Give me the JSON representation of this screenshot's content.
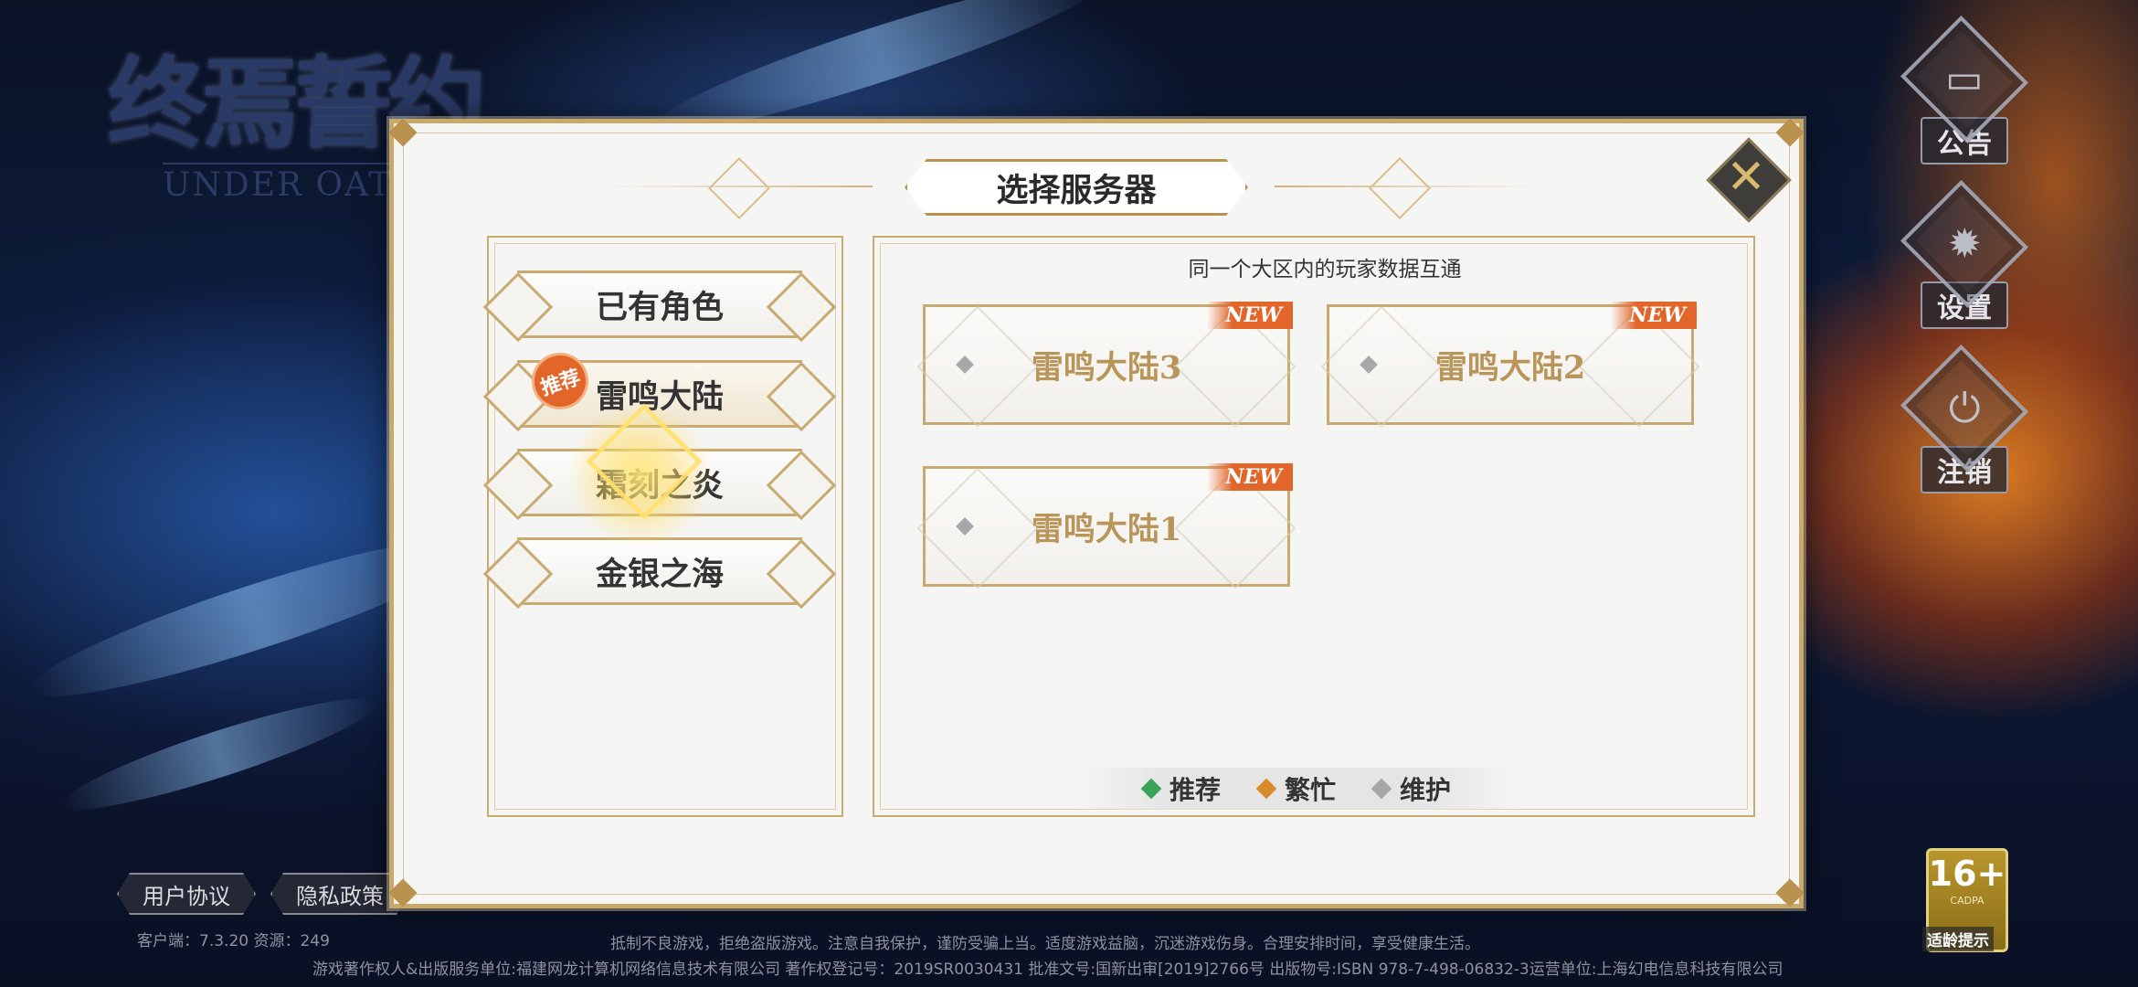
{
  "logo": {
    "cn": "终焉誓约",
    "en": "UNDER OATH"
  },
  "side_menu": [
    {
      "label": "公告",
      "icon": "notice-icon",
      "glyph": "▭"
    },
    {
      "label": "设置",
      "icon": "gear-icon",
      "glyph": "✹"
    },
    {
      "label": "注销",
      "icon": "power-icon",
      "glyph": "⏻"
    }
  ],
  "bottom": {
    "user_agreement": "用户协议",
    "privacy_policy": "隐私政策",
    "version": "客户端：7.3.20   资源：249",
    "notice_line1": "抵制不良游戏，拒绝盗版游戏。注意自我保护，谨防受骗上当。适度游戏益脑，沉迷游戏伤身。合理安排时间，享受健康生活。",
    "notice_line2": "游戏著作权人&出版服务单位:福建网龙计算机网络信息技术有限公司  著作权登记号：2019SR0030431  批准文号:国新出审[2019]2766号  出版物号:ISBN 978-7-498-06832-3运营单位:上海幻电信息科技有限公司",
    "age_rating": "16+",
    "age_sub": "CADPA",
    "age_label": "适龄提示"
  },
  "dialog": {
    "title": "选择服务器",
    "close_glyph": "✕",
    "hint": "同一个大区内的玩家数据互通",
    "tabs": [
      {
        "label": "已有角色"
      },
      {
        "label": "雷鸣大陆"
      },
      {
        "label": "霜刻之炎"
      },
      {
        "label": "金银之海"
      }
    ],
    "recommend_badge": "推荐",
    "servers": [
      {
        "name": "雷鸣大陆3",
        "tag": "NEW"
      },
      {
        "name": "雷鸣大陆2",
        "tag": "NEW"
      },
      {
        "name": "雷鸣大陆1",
        "tag": "NEW"
      }
    ],
    "legend": [
      {
        "label": "推荐",
        "color": "#3aa35a"
      },
      {
        "label": "繁忙",
        "color": "#d98a2a"
      },
      {
        "label": "维护",
        "color": "#a8a8a8"
      }
    ]
  }
}
